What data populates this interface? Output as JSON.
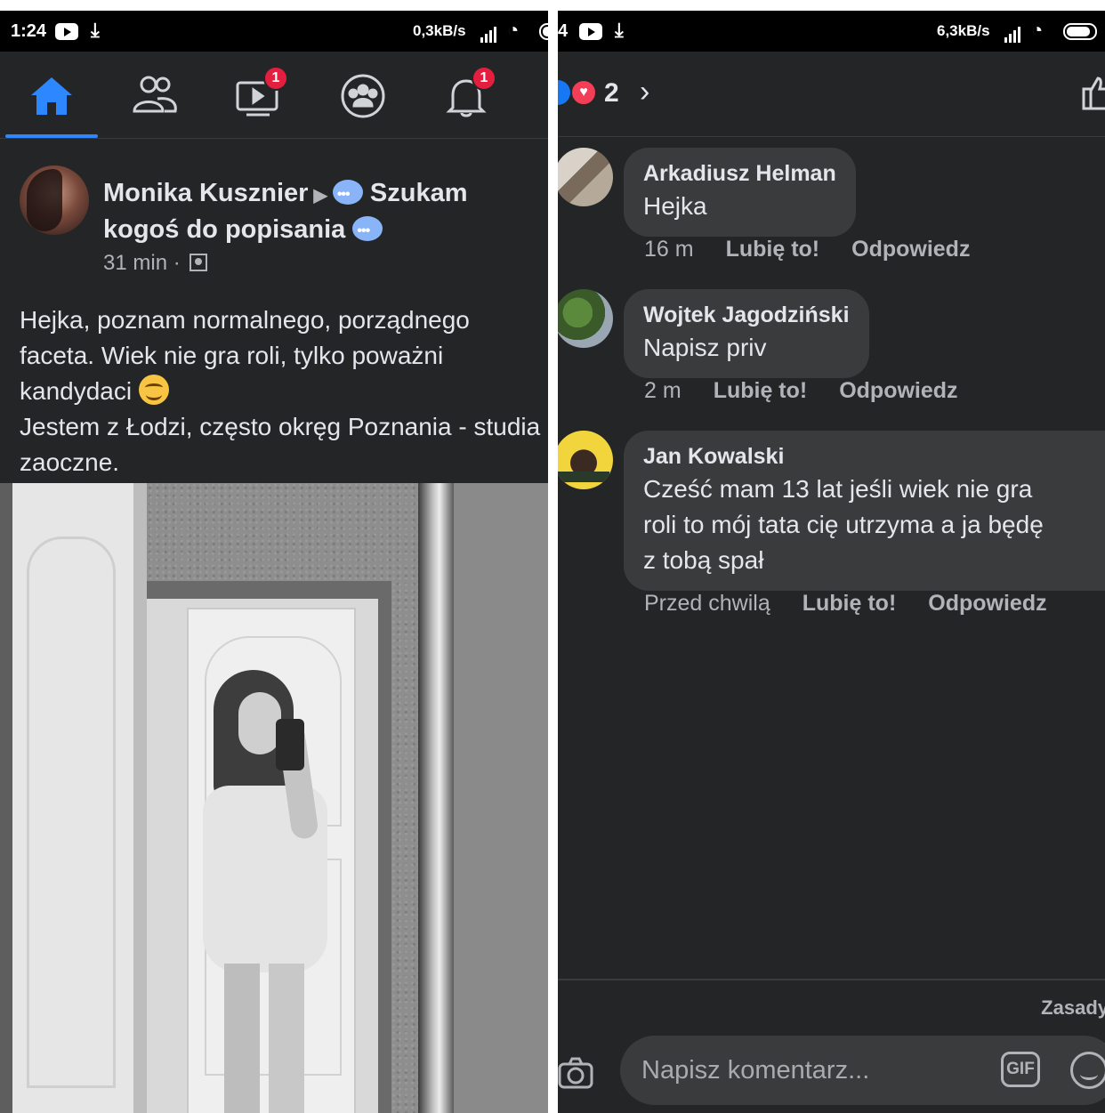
{
  "left": {
    "status": {
      "time": "1:24",
      "speed": "0,3kB/s"
    },
    "nav": {
      "items": [
        "home",
        "friends",
        "watch",
        "groups",
        "notifications"
      ],
      "watch_badge": "1",
      "notifications_badge": "1"
    },
    "post": {
      "author": "Monika Kusznier",
      "group": "Szukam kogoś do popisania",
      "time": "31 min",
      "privacy_icon": "group-icon",
      "text_lines": [
        "Hejka, poznam normalnego, porządnego",
        "faceta. Wiek nie gra roli, tylko poważni",
        "kandydaci",
        "Jestem z Łodzi, często okręg Poznania - studia",
        "zaoczne."
      ]
    }
  },
  "right": {
    "status": {
      "time": "4",
      "speed": "6,3kB/s"
    },
    "reactions": {
      "count": "2"
    },
    "comments": [
      {
        "name": "Arkadiusz Helman",
        "lines": [
          "Hejka"
        ],
        "time": "16 m",
        "like": "Lubię to!",
        "reply": "Odpowiedz"
      },
      {
        "name": "Wojtek Jagodziński",
        "lines": [
          "Napisz priv"
        ],
        "time": "2 m",
        "like": "Lubię to!",
        "reply": "Odpowiedz"
      },
      {
        "name": "Jan Kowalski",
        "lines": [
          "Cześć mam 13 lat jeśli wiek nie gra",
          "roli to mój tata cię utrzyma a ja będę",
          "z tobą spał"
        ],
        "time": "Przed chwilą",
        "like": "Lubię to!",
        "reply": "Odpowiedz"
      }
    ],
    "rules_link": "Zasady",
    "input_placeholder": "Napisz komentarz...",
    "gif_label": "GIF"
  },
  "colors": {
    "accent": "#2d88ff",
    "badge": "#e41e3f",
    "background": "#242526",
    "bubble": "#3a3b3c"
  }
}
